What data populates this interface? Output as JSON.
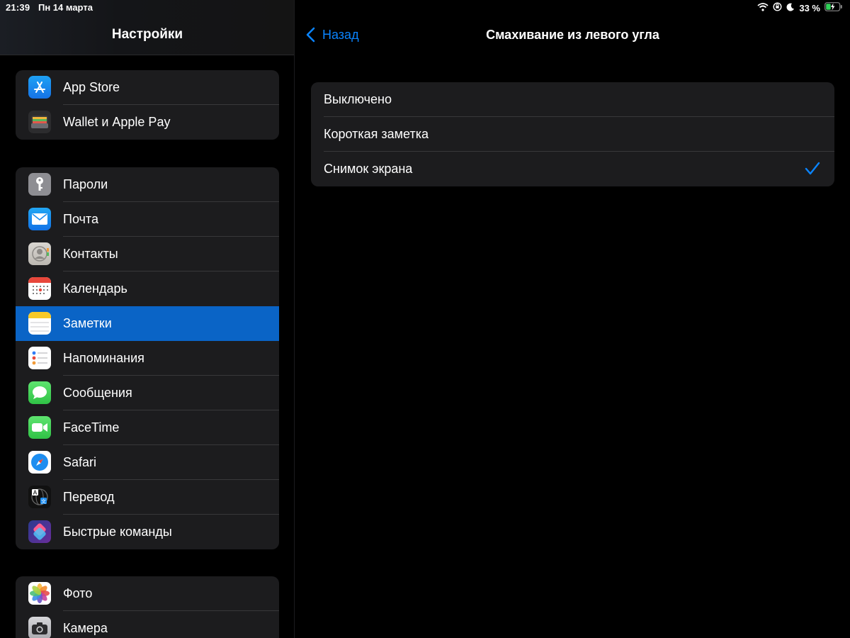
{
  "status_bar": {
    "time": "21:39",
    "date": "Пн 14 марта",
    "battery_percent": "33 %"
  },
  "sidebar": {
    "title": "Настройки",
    "groups": [
      {
        "items": [
          {
            "label": "App Store",
            "icon": "app-store-icon"
          },
          {
            "label": "Wallet и Apple Pay",
            "icon": "wallet-icon"
          }
        ]
      },
      {
        "items": [
          {
            "label": "Пароли",
            "icon": "key-icon"
          },
          {
            "label": "Почта",
            "icon": "mail-icon"
          },
          {
            "label": "Контакты",
            "icon": "contacts-icon"
          },
          {
            "label": "Календарь",
            "icon": "calendar-icon"
          },
          {
            "label": "Заметки",
            "icon": "notes-icon",
            "selected": true
          },
          {
            "label": "Напоминания",
            "icon": "reminders-icon"
          },
          {
            "label": "Сообщения",
            "icon": "messages-icon"
          },
          {
            "label": "FaceTime",
            "icon": "facetime-icon"
          },
          {
            "label": "Safari",
            "icon": "safari-icon"
          },
          {
            "label": "Перевод",
            "icon": "translate-icon"
          },
          {
            "label": "Быстрые команды",
            "icon": "shortcuts-icon"
          }
        ]
      },
      {
        "items": [
          {
            "label": "Фото",
            "icon": "photos-icon"
          },
          {
            "label": "Камера",
            "icon": "camera-icon"
          }
        ]
      }
    ]
  },
  "detail": {
    "back_label": "Назад",
    "title": "Смахивание из левого угла",
    "options": [
      {
        "label": "Выключено",
        "checked": false
      },
      {
        "label": "Короткая заметка",
        "checked": false
      },
      {
        "label": "Снимок экрана",
        "checked": true
      }
    ]
  },
  "colors": {
    "accent": "#0a84ff",
    "selection": "#0a64c6",
    "group_bg": "#1c1c1e",
    "separator": "#38383a"
  }
}
